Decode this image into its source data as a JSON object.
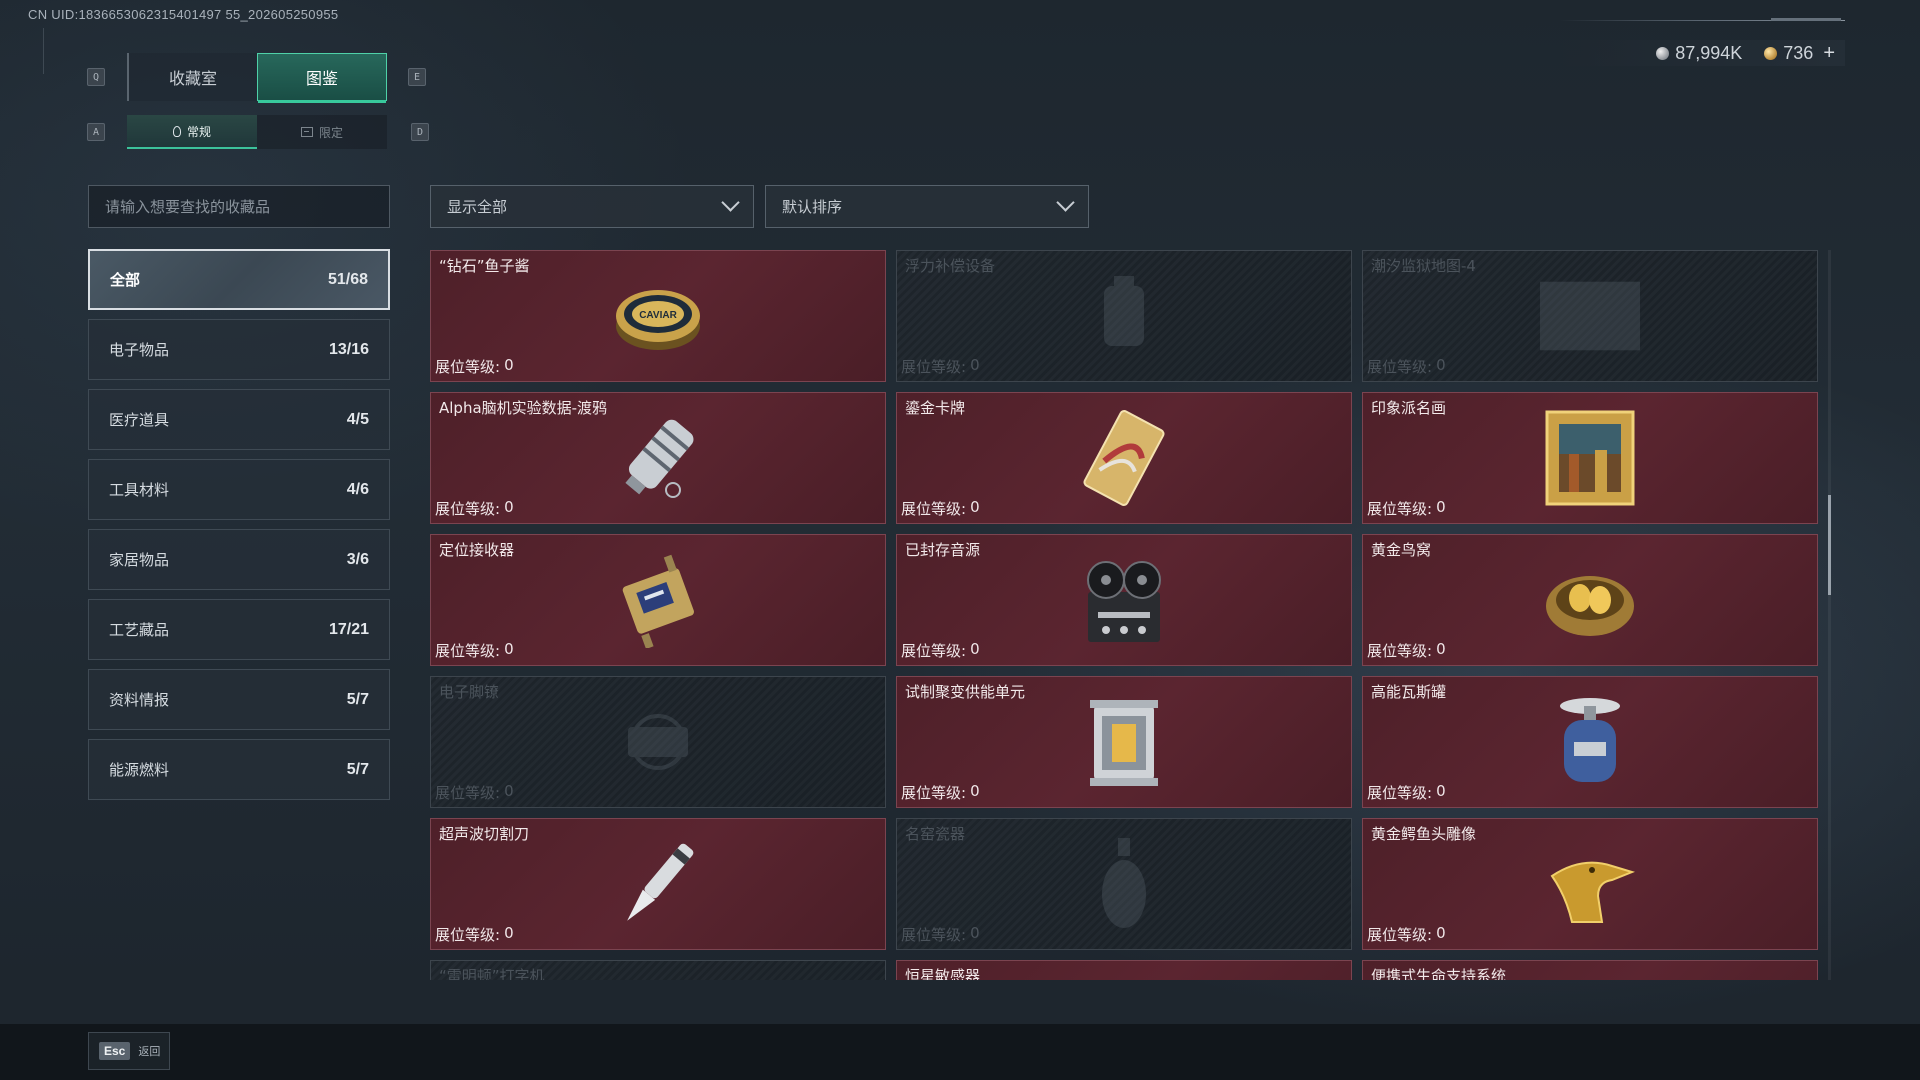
{
  "uid": "CN UID:1836653062315401497 55_202605250955",
  "currency": {
    "silver": "87,994K",
    "gold": "736",
    "plus": "+"
  },
  "keys": {
    "q": "Q",
    "e": "E",
    "a": "A",
    "d": "D"
  },
  "tabs": [
    {
      "label": "收藏室",
      "active": false
    },
    {
      "label": "图鉴",
      "active": true
    }
  ],
  "subtabs": [
    {
      "label": "常规",
      "icon": "flame-icon",
      "active": true
    },
    {
      "label": "限定",
      "icon": "image-icon",
      "active": false
    }
  ],
  "search": {
    "placeholder": "请输入想要查找的收藏品"
  },
  "filters": {
    "show": "显示全部",
    "sort": "默认排序"
  },
  "categories": [
    {
      "name": "全部",
      "count": "51/68",
      "active": true
    },
    {
      "name": "电子物品",
      "count": "13/16"
    },
    {
      "name": "医疗道具",
      "count": "4/5"
    },
    {
      "name": "工具材料",
      "count": "4/6"
    },
    {
      "name": "家居物品",
      "count": "3/6"
    },
    {
      "name": "工艺藏品",
      "count": "17/21"
    },
    {
      "name": "资料情报",
      "count": "5/7"
    },
    {
      "name": "能源燃料",
      "count": "5/7"
    }
  ],
  "level_label": "展位等级:",
  "items": [
    {
      "name": "“钻石”鱼子酱",
      "level": "0",
      "locked": false,
      "icon": "caviar-tin-icon"
    },
    {
      "name": "浮力补偿设备",
      "level": "0",
      "locked": true,
      "icon": "buoyancy-device-icon"
    },
    {
      "name": "潮汐监狱地图-4",
      "level": "0",
      "locked": true,
      "icon": "map-icon"
    },
    {
      "name": "Alpha脑机实验数据-渡鸦",
      "level": "0",
      "locked": false,
      "icon": "data-canister-icon"
    },
    {
      "name": "鎏金卡牌",
      "level": "0",
      "locked": false,
      "icon": "gilded-card-icon"
    },
    {
      "name": "印象派名画",
      "level": "0",
      "locked": false,
      "icon": "painting-icon"
    },
    {
      "name": "定位接收器",
      "level": "0",
      "locked": false,
      "icon": "receiver-icon"
    },
    {
      "name": "已封存音源",
      "level": "0",
      "locked": false,
      "icon": "tape-recorder-icon"
    },
    {
      "name": "黄金鸟窝",
      "level": "0",
      "locked": false,
      "icon": "golden-nest-icon"
    },
    {
      "name": "电子脚镣",
      "level": "0",
      "locked": true,
      "icon": "ankle-monitor-icon"
    },
    {
      "name": "试制聚变供能单元",
      "level": "0",
      "locked": false,
      "icon": "fusion-unit-icon"
    },
    {
      "name": "高能瓦斯罐",
      "level": "0",
      "locked": false,
      "icon": "gas-canister-icon"
    },
    {
      "name": "超声波切割刀",
      "level": "0",
      "locked": false,
      "icon": "ultrasonic-knife-icon"
    },
    {
      "name": "名窑瓷器",
      "level": "0",
      "locked": true,
      "icon": "vase-icon"
    },
    {
      "name": "黄金鳄鱼头雕像",
      "level": "0",
      "locked": false,
      "icon": "crocodile-statue-icon"
    },
    {
      "name": "“雷明顿”打字机",
      "level": "",
      "locked": true,
      "icon": "typewriter-icon"
    },
    {
      "name": "恒星敏感器",
      "level": "",
      "locked": false,
      "icon": "star-sensor-icon"
    },
    {
      "name": "便携式生命支持系统",
      "level": "",
      "locked": false,
      "icon": "life-support-icon"
    }
  ],
  "footer": {
    "key": "Esc",
    "label": "返回"
  }
}
